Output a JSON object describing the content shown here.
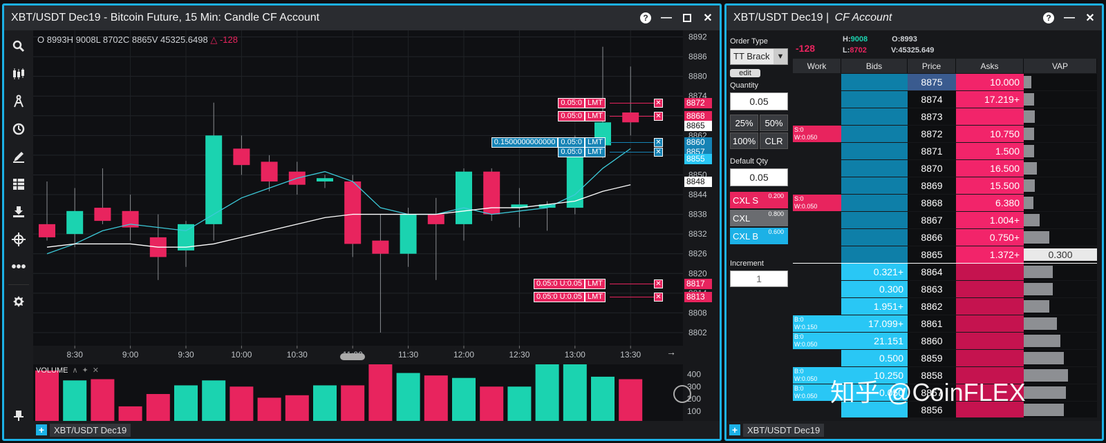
{
  "chart_window": {
    "title": "XBT/USDT Dec19 - Bitcoin Future, 15 Min: Candle CF Account",
    "ohlc_text": "O 8993H 9008L 8702C 8865V 45325.6498",
    "ohlc_change": "△ -128",
    "volume_label": "VOLUME",
    "tab_label": "XBT/USDT Dec19",
    "tools": [
      "search-icon",
      "candles-icon",
      "drawing-icon",
      "clock-icon",
      "pencil-icon",
      "layout-icon",
      "download-icon",
      "crosshair-icon",
      "more-icon",
      "settings-icon",
      "pin-icon"
    ]
  },
  "chart_data": {
    "type": "candlestick",
    "x": [
      "8:15",
      "8:30",
      "8:45",
      "9:00",
      "9:15",
      "9:30",
      "9:45",
      "10:00",
      "10:15",
      "10:30",
      "10:45",
      "11:00",
      "11:15",
      "11:30",
      "11:45",
      "12:00",
      "12:15",
      "12:30",
      "12:45",
      "13:00",
      "13:15",
      "13:30"
    ],
    "x_tick_labels": [
      "8:30",
      "9:00",
      "9:30",
      "10:00",
      "10:30",
      "11:00",
      "11:30",
      "12:00",
      "12:30",
      "13:00",
      "13:30"
    ],
    "y_tick_labels": [
      "8892",
      "8886",
      "8880",
      "8874",
      "8868",
      "8862",
      "8856",
      "8850",
      "8844",
      "8838",
      "8832",
      "8826",
      "8820",
      "8814",
      "8808",
      "8802"
    ],
    "ylim": [
      8798,
      8894
    ],
    "candles": [
      {
        "o": 8835,
        "h": 8848,
        "l": 8830,
        "c": 8831
      },
      {
        "o": 8832,
        "h": 8846,
        "l": 8828,
        "c": 8839
      },
      {
        "o": 8840,
        "h": 8852,
        "l": 8835,
        "c": 8836
      },
      {
        "o": 8839,
        "h": 8844,
        "l": 8830,
        "c": 8834
      },
      {
        "o": 8831,
        "h": 8838,
        "l": 8818,
        "c": 8825
      },
      {
        "o": 8827,
        "h": 8836,
        "l": 8822,
        "c": 8835
      },
      {
        "o": 8835,
        "h": 8872,
        "l": 8830,
        "c": 8862
      },
      {
        "o": 8858,
        "h": 8862,
        "l": 8850,
        "c": 8853
      },
      {
        "o": 8854,
        "h": 8856,
        "l": 8845,
        "c": 8848
      },
      {
        "o": 8851,
        "h": 8854,
        "l": 8844,
        "c": 8847
      },
      {
        "o": 8848,
        "h": 8850,
        "l": 8846,
        "c": 8849
      },
      {
        "o": 8848,
        "h": 8850,
        "l": 8825,
        "c": 8829
      },
      {
        "o": 8830,
        "h": 8838,
        "l": 8802,
        "c": 8826
      },
      {
        "o": 8826,
        "h": 8840,
        "l": 8822,
        "c": 8838
      },
      {
        "o": 8838,
        "h": 8843,
        "l": 8818,
        "c": 8835
      },
      {
        "o": 8835,
        "h": 8852,
        "l": 8830,
        "c": 8851
      },
      {
        "o": 8851,
        "h": 8852,
        "l": 8836,
        "c": 8838
      },
      {
        "o": 8840,
        "h": 8846,
        "l": 8834,
        "c": 8841
      },
      {
        "o": 8840,
        "h": 8842,
        "l": 8833,
        "c": 8841
      },
      {
        "o": 8840,
        "h": 8862,
        "l": 8838,
        "c": 8859
      },
      {
        "o": 8859,
        "h": 8889,
        "l": 8855,
        "c": 8866
      },
      {
        "o": 8869,
        "h": 8883,
        "l": 8862,
        "c": 8866
      }
    ],
    "ema_fast": [
      8826,
      8829,
      8833,
      8835,
      8834,
      8833,
      8838,
      8843,
      8846,
      8849,
      8851,
      8848,
      8840,
      8838,
      8838,
      8840,
      8838,
      8839,
      8840,
      8844,
      8852,
      8858
    ],
    "ema_slow": [
      8828,
      8829,
      8829,
      8829,
      8828,
      8828,
      8829,
      8831,
      8833,
      8835,
      8837,
      8838,
      8838,
      8838,
      8838,
      8839,
      8840,
      8840,
      8841,
      8842,
      8845,
      8847
    ],
    "volume": [
      430,
      350,
      360,
      140,
      240,
      310,
      350,
      300,
      210,
      230,
      310,
      310,
      480,
      410,
      390,
      370,
      300,
      300,
      490,
      490,
      380,
      360
    ],
    "volume_ticks": [
      "400",
      "300",
      "200",
      "100"
    ],
    "volume_ylim": [
      0,
      480
    ],
    "price_labels": [
      {
        "price": "8872",
        "color": "#e8245e"
      },
      {
        "price": "8868",
        "color": "#e8245e"
      },
      {
        "price": "8865",
        "color": "#ffffff"
      },
      {
        "price": "8860",
        "color": "#1583b5"
      },
      {
        "price": "8857",
        "color": "#1583b5"
      },
      {
        "price": "8855",
        "color": "#29c7f5"
      },
      {
        "price": "8848",
        "color": "#ffffff"
      },
      {
        "price": "8817",
        "color": "#e8245e"
      },
      {
        "price": "8813",
        "color": "#e8245e"
      }
    ],
    "orders": [
      {
        "price": 8872,
        "qty": "0.05:0",
        "type": "LMT",
        "color": "#e8245e"
      },
      {
        "price": 8868,
        "qty": "0.05:0",
        "type": "LMT",
        "color": "#e8245e"
      },
      {
        "price": 8860,
        "qty": "0.05:0",
        "type": "LMT",
        "color": "#1583b5",
        "extra": "0.1500000000000"
      },
      {
        "price": 8857,
        "qty": "0.05:0",
        "type": "LMT",
        "color": "#1583b5"
      },
      {
        "price": 8817,
        "qty": "0.05:0 U:0.05",
        "type": "LMT",
        "color": "#e8245e"
      },
      {
        "price": 8813,
        "qty": "0.05:0 U:0.05",
        "type": "LMT",
        "color": "#e8245e"
      }
    ]
  },
  "ladder_window": {
    "title_main": "XBT/USDT Dec19 | ",
    "title_account": "CF Account",
    "change": "-128",
    "stats": {
      "h_label": "H:",
      "h": "9008",
      "l_label": "L:",
      "l": "8702",
      "o_label": "O:",
      "o": "8993",
      "v_label": "V:",
      "v": "45325.649"
    },
    "order_type_label": "Order Type",
    "order_type_value": "TT Brack",
    "edit_label": "edit",
    "quantity_label": "Quantity",
    "quantity_value": "0.05",
    "pct_buttons": [
      "25%",
      "50%",
      "100%",
      "CLR"
    ],
    "default_qty_label": "Default Qty",
    "default_qty_value": "0.05",
    "cxl_s": {
      "label": "CXL S",
      "value": "0.200"
    },
    "cxl": {
      "label": "CXL",
      "value": "0.800"
    },
    "cxl_b": {
      "label": "CXL B",
      "value": "0.600"
    },
    "increment_label": "Increment",
    "increment_value": "1",
    "headers": [
      "Work",
      "Bids",
      "Price",
      "Asks",
      "VAP"
    ],
    "tab_label": "XBT/USDT Dec19",
    "watermark": "知乎 @CoinFLEX",
    "rows": [
      {
        "price": "8875",
        "work": "",
        "bid": "",
        "ask": "10.000",
        "vap": "",
        "vapw": 10
      },
      {
        "price": "8874",
        "work": "",
        "bid": "",
        "ask": "17.219+",
        "vap": "",
        "vapw": 14
      },
      {
        "price": "8873",
        "work": "",
        "bid": "",
        "ask": "",
        "vap": "",
        "vapw": 15
      },
      {
        "price": "8872",
        "work": "S:0\nW:0.050",
        "bid": "",
        "ask": "10.750",
        "vap": "",
        "vapw": 14
      },
      {
        "price": "8871",
        "work": "",
        "bid": "",
        "ask": "1.500",
        "vap": "",
        "vapw": 14
      },
      {
        "price": "8870",
        "work": "",
        "bid": "",
        "ask": "16.500",
        "vap": "",
        "vapw": 18
      },
      {
        "price": "8869",
        "work": "",
        "bid": "",
        "ask": "15.500",
        "vap": "",
        "vapw": 15
      },
      {
        "price": "8868",
        "work": "S:0\nW:0.050",
        "bid": "",
        "ask": "6.380",
        "vap": "",
        "vapw": 13
      },
      {
        "price": "8867",
        "work": "",
        "bid": "",
        "ask": "1.004+",
        "vap": "",
        "vapw": 22
      },
      {
        "price": "8866",
        "work": "",
        "bid": "",
        "ask": "0.750+",
        "vap": "",
        "vapw": 35
      },
      {
        "price": "8865",
        "work": "",
        "bid": "",
        "ask": "1.372+",
        "vap": "0.300",
        "vapw": 100
      },
      {
        "price": "8864",
        "work": "",
        "bid": "0.321+",
        "ask": "",
        "vap": "",
        "vapw": 40
      },
      {
        "price": "8863",
        "work": "",
        "bid": "0.300",
        "ask": "",
        "vap": "",
        "vapw": 40
      },
      {
        "price": "8862",
        "work": "",
        "bid": "1.951+",
        "ask": "",
        "vap": "",
        "vapw": 35
      },
      {
        "price": "8861",
        "work": "B:0\nW:0.150",
        "bid": "17.099+",
        "ask": "",
        "vap": "",
        "vapw": 45
      },
      {
        "price": "8860",
        "work": "B:0\nW:0.050",
        "bid": "21.151",
        "ask": "",
        "vap": "",
        "vapw": 50
      },
      {
        "price": "8859",
        "work": "",
        "bid": "0.500",
        "ask": "",
        "vap": "",
        "vapw": 55
      },
      {
        "price": "8858",
        "work": "B:0\nW:0.050",
        "bid": "10.250",
        "ask": "",
        "vap": "",
        "vapw": 60
      },
      {
        "price": "8857",
        "work": "B:0\nW:0.050",
        "bid": "0.050",
        "ask": "",
        "vap": "",
        "vapw": 58
      },
      {
        "price": "8856",
        "work": "",
        "bid": "",
        "ask": "",
        "vap": "",
        "vapw": 55
      }
    ]
  }
}
